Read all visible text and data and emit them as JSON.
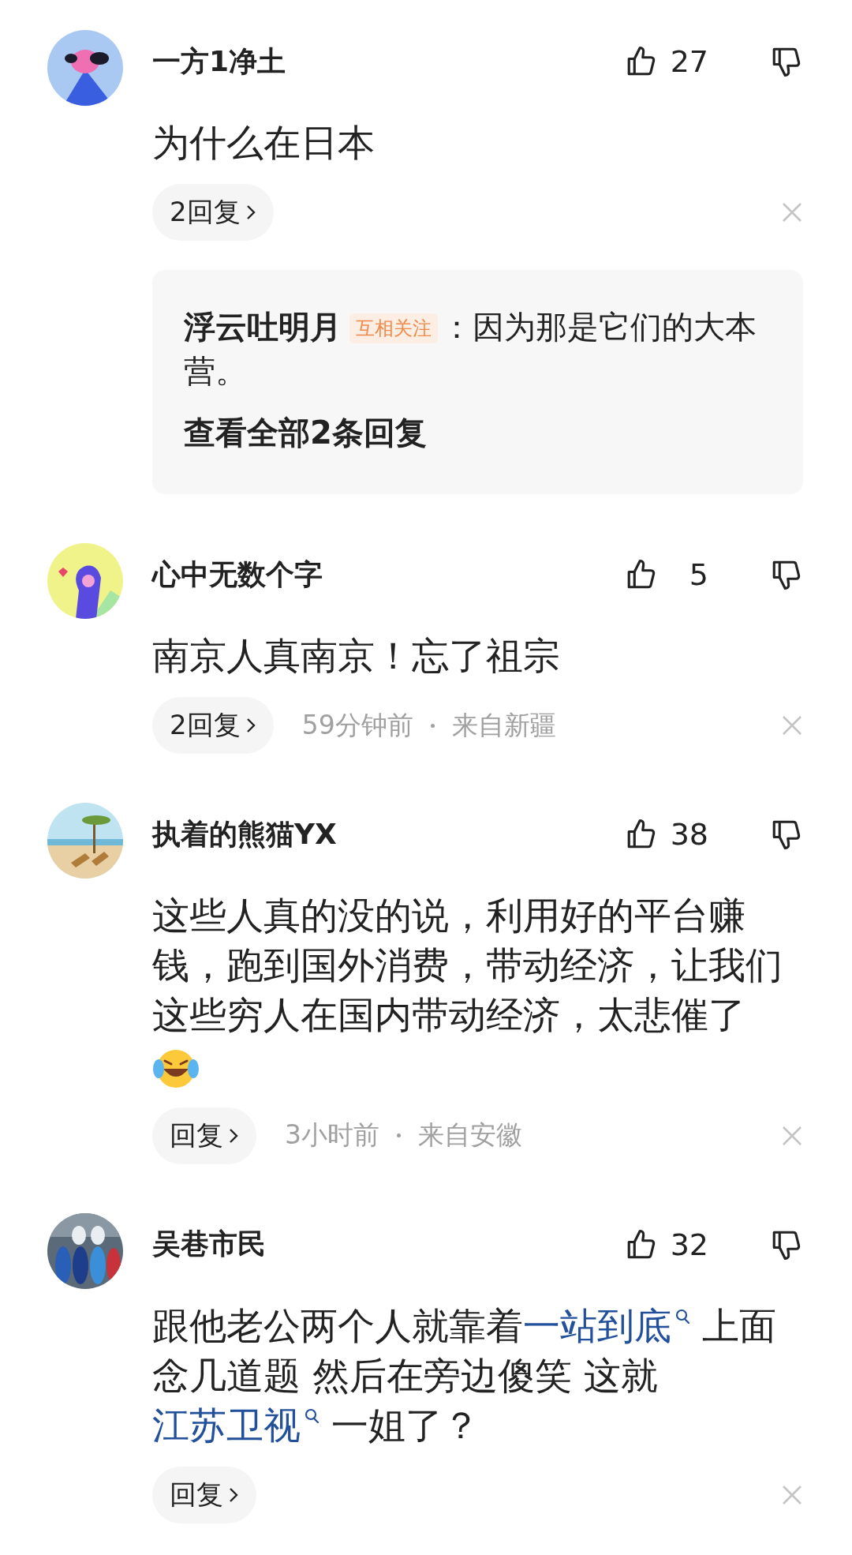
{
  "comments": [
    {
      "avatar": {
        "kind": "dog"
      },
      "user": "一方1净土",
      "likes": "27",
      "body": [
        {
          "kind": "text",
          "text": "为什么在日本"
        }
      ],
      "reply_button": "2回复",
      "thread": {
        "replies": [
          {
            "user": "浮云吐明月",
            "badge": "互相关注",
            "text": "：因为那是它们的大本营。"
          }
        ],
        "view_all": "查看全部2条回复"
      }
    },
    {
      "avatar": {
        "kind": "paw"
      },
      "user": "心中无数个字",
      "likes": "5",
      "body": [
        {
          "kind": "text",
          "text": "南京人真南京！忘了祖宗"
        }
      ],
      "reply_button": "2回复",
      "meta": [
        "59分钟前",
        "来自新疆"
      ]
    },
    {
      "avatar": {
        "kind": "beach"
      },
      "user": "执着的熊猫YX",
      "likes": "38",
      "body": [
        {
          "kind": "text",
          "text": "这些人真的没的说，利用好的平台赚钱，跑到国外消费，带动经济，让我们这些穷人在国内带动经济，太悲催了"
        },
        {
          "kind": "emoji"
        }
      ],
      "reply_button": "回复",
      "meta": [
        "3小时前",
        "来自安徽"
      ]
    },
    {
      "avatar": {
        "kind": "boats"
      },
      "user": "吴巷市民",
      "likes": "32",
      "body": [
        {
          "kind": "text",
          "text": "跟他老公两个人就靠着"
        },
        {
          "kind": "link",
          "text": "一站到底"
        },
        {
          "kind": "text",
          "text": " 上面念几道题 然后在旁边傻笑 这就"
        },
        {
          "kind": "link",
          "text": "江苏卫视"
        },
        {
          "kind": "text",
          "text": " 一姐了？"
        }
      ],
      "reply_button": "回复"
    }
  ]
}
